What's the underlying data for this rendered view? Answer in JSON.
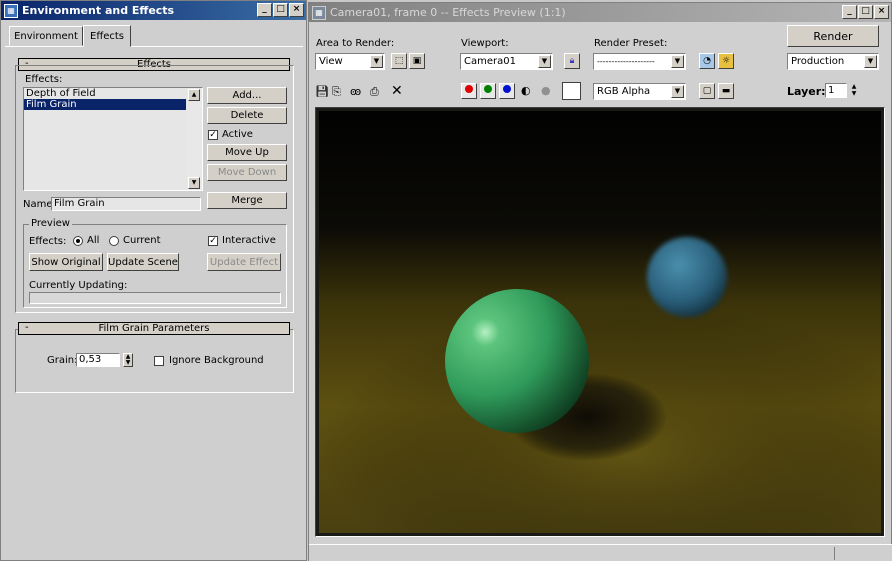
{
  "env_window": {
    "title": "Environment and Effects",
    "tabs": [
      "Environment",
      "Effects"
    ],
    "effects_rollout": {
      "header": "Effects",
      "effects_label": "Effects:",
      "items": [
        "Depth of Field",
        "Film Grain"
      ],
      "add_label": "Add...",
      "delete_label": "Delete",
      "active_label": "Active",
      "move_up_label": "Move Up",
      "move_down_label": "Move Down",
      "name_label": "Name:",
      "name_value": "Film Grain",
      "merge_label": "Merge",
      "preview_label": "Preview",
      "effects_radio_label": "Effects:",
      "radio_all": "All",
      "radio_current": "Current",
      "interactive_label": "Interactive",
      "show_original_label": "Show Original",
      "update_scene_label": "Update Scene",
      "update_effect_label": "Update Effect",
      "currently_updating_label": "Currently Updating:"
    },
    "film_grain_rollout": {
      "header": "Film Grain Parameters",
      "grain_label": "Grain:",
      "grain_value": "0,53",
      "ignore_background_label": "Ignore Background"
    }
  },
  "render_window": {
    "title": "Camera01, frame 0 -- Effects Preview (1:1)",
    "area_label": "Area to Render:",
    "area_value": "View",
    "viewport_label": "Viewport:",
    "viewport_value": "Camera01",
    "preset_label": "Render Preset:",
    "preset_value": "--------------------",
    "render_label": "Render",
    "production_value": "Production",
    "channel_value": "RGB Alpha",
    "layer_label": "Layer:",
    "layer_value": "1"
  },
  "colors": {
    "active_title": "#0a246a",
    "selection": "#0a246a",
    "green_sphere": "#2f9a5a",
    "blue_sphere": "#2a5f7a",
    "floor": "#5d5010"
  }
}
